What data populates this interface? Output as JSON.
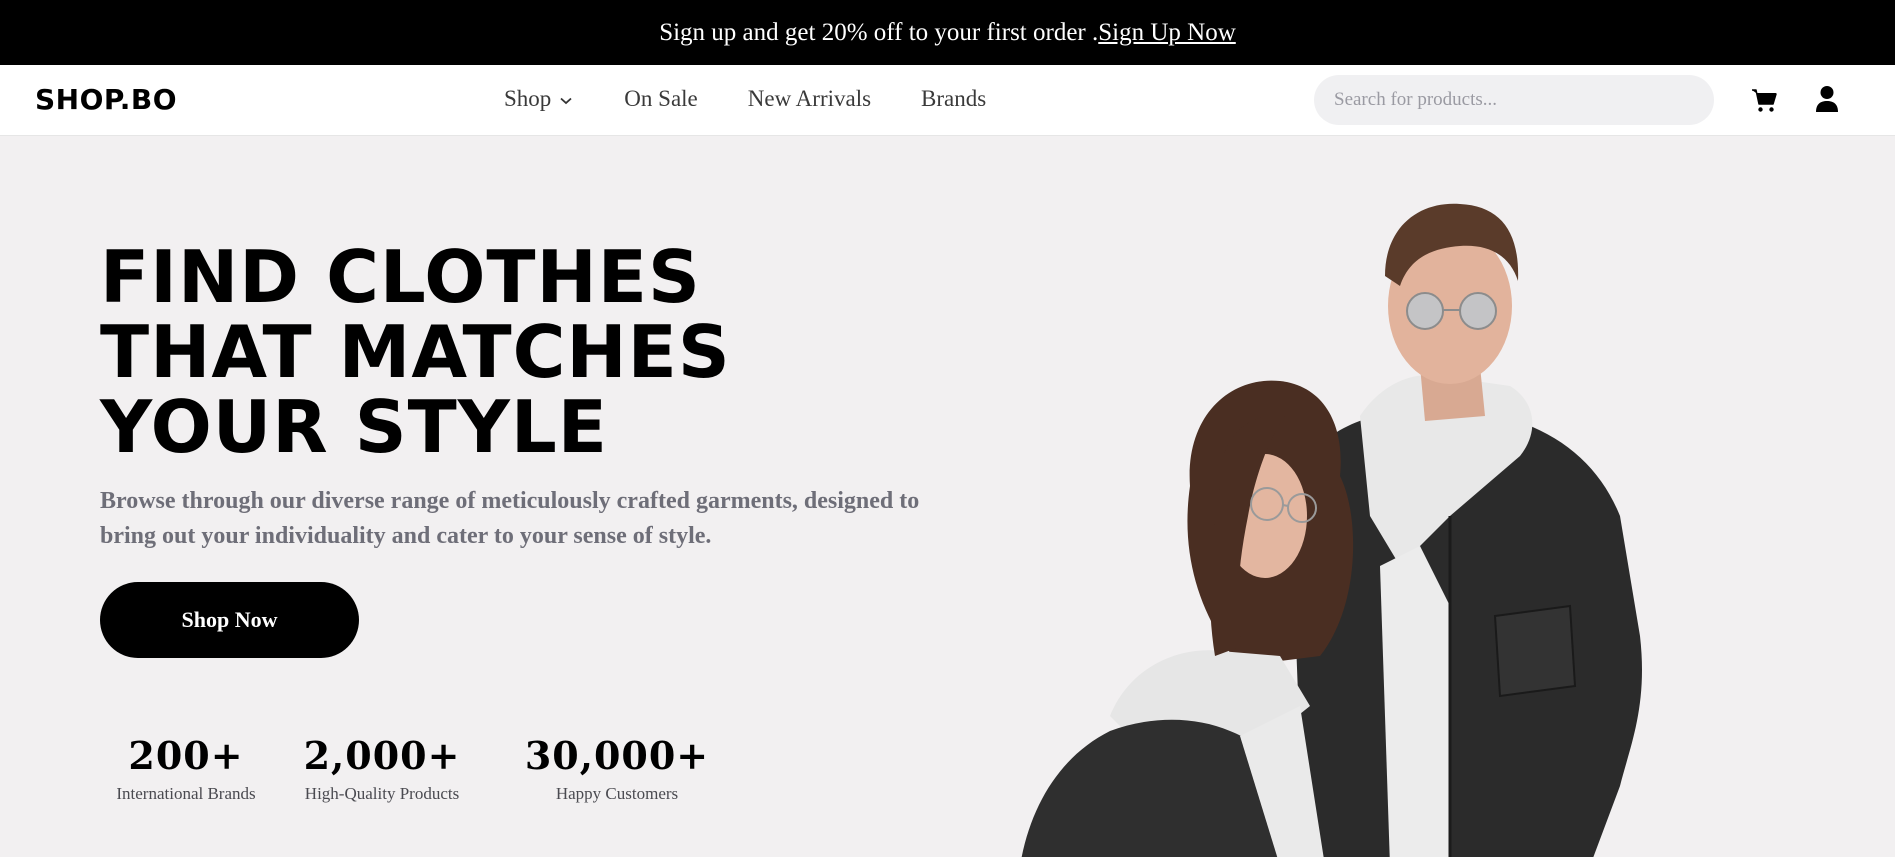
{
  "banner": {
    "text": "Sign up and get 20% off to your first order .",
    "link_label": "Sign Up Now"
  },
  "navbar": {
    "logo": "SHOP.BO",
    "links": [
      {
        "label": "Shop",
        "has_dropdown": true
      },
      {
        "label": "On Sale"
      },
      {
        "label": "New Arrivals"
      },
      {
        "label": "Brands"
      }
    ],
    "search": {
      "placeholder": "Search for products...",
      "value": ""
    },
    "icons": [
      "cart-icon",
      "user-icon"
    ]
  },
  "hero": {
    "headline_lines": [
      "FIND CLOTHES",
      "THAT MATCHES",
      "YOUR STYLE"
    ],
    "subtext": "Browse through our diverse range of meticulously crafted garments, designed to bring out your individuality and cater to your sense of style.",
    "cta_label": "Shop Now",
    "stats": [
      {
        "value": "200+",
        "label": "International Brands"
      },
      {
        "value": "2,000+",
        "label": "High-Quality Products"
      },
      {
        "value": "30,000+",
        "label": "Happy Customers"
      }
    ]
  },
  "colors": {
    "banner_bg": "#000000",
    "hero_bg": "#f2f0f1",
    "cta_bg": "#000000",
    "subtext": "#6e6e78"
  }
}
